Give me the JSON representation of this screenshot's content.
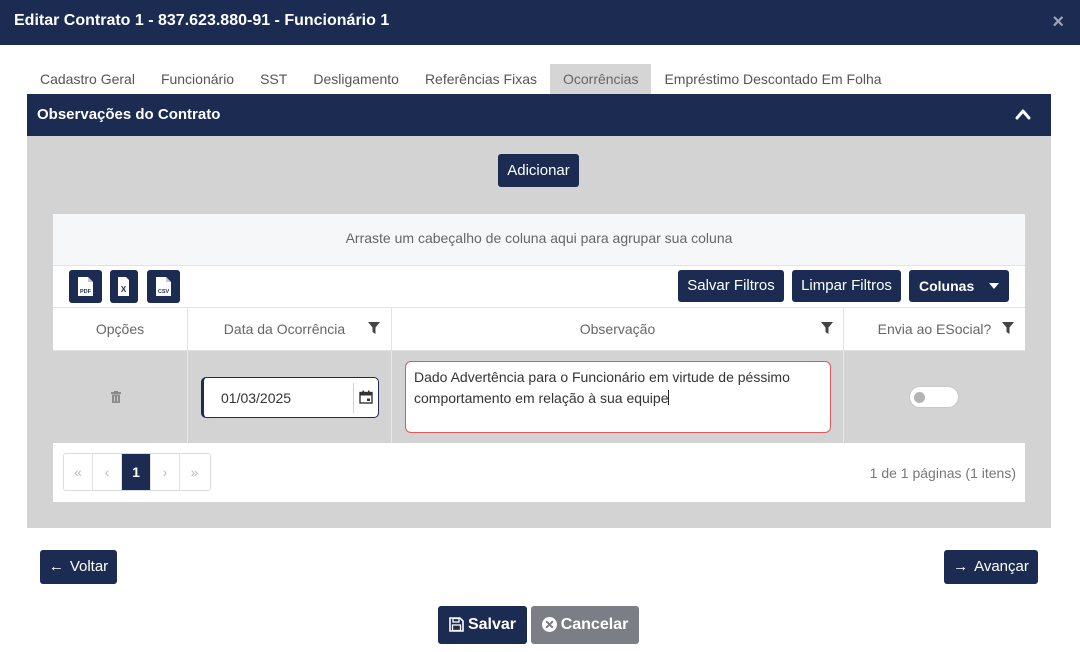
{
  "modal": {
    "title": "Editar Contrato 1 - 837.623.880-91 - Funcionário 1",
    "close_symbol": "×"
  },
  "tabs": [
    {
      "label": "Cadastro Geral"
    },
    {
      "label": "Funcionário"
    },
    {
      "label": "SST"
    },
    {
      "label": "Desligamento"
    },
    {
      "label": "Referências Fixas"
    },
    {
      "label": "Ocorrências",
      "active": true
    },
    {
      "label": "Empréstimo Descontado Em Folha"
    }
  ],
  "panel": {
    "title": "Observações do Contrato",
    "collapse_icon": "chevron-up-icon"
  },
  "actions": {
    "add_label": "Adicionar"
  },
  "grid": {
    "group_hint": "Arraste um cabeçalho de coluna aqui para agrupar sua coluna",
    "export_icons": [
      "pdf-export-icon",
      "excel-export-icon",
      "csv-export-icon"
    ],
    "export_labels": {
      "pdf": "PDF",
      "excel": "X",
      "csv": "CSV"
    },
    "save_filters_label": "Salvar Filtros",
    "clear_filters_label": "Limpar Filtros",
    "columns_label": "Colunas",
    "headers": {
      "options": "Opções",
      "date": "Data da Ocorrência",
      "observation": "Observação",
      "esocial": "Envia ao ESocial?"
    },
    "rows": [
      {
        "date": "01/03/2025",
        "observation": "Dado Advertência para o Funcionário em virtude de péssimo comportamento em relação à sua equipe",
        "envia_esocial": false
      }
    ],
    "pagination": {
      "first": "«",
      "prev": "‹",
      "current": "1",
      "next": "›",
      "last": "»",
      "info": "1 de 1 páginas (1 itens)"
    }
  },
  "footer": {
    "back_label": "Voltar",
    "next_label": "Avançar",
    "save_label": "Salvar",
    "cancel_label": "Cancelar"
  },
  "colors": {
    "primary": "#1b2b52",
    "panel_bg": "#d3d3d3",
    "cancel_bg": "#7b7f85",
    "invalid_border": "#e05858"
  }
}
